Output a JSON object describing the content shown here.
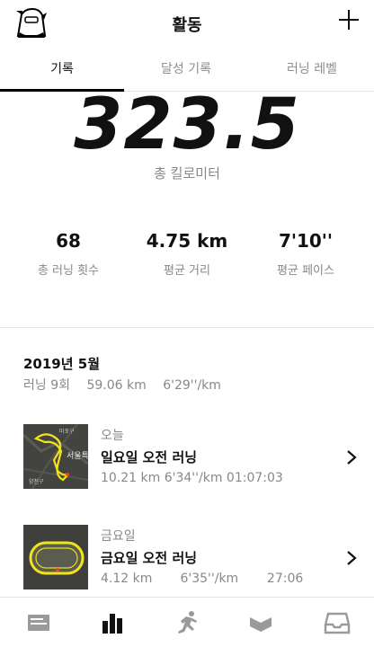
{
  "header": {
    "title": "활동"
  },
  "tabs": [
    {
      "label": "기록",
      "active": true
    },
    {
      "label": "달성 기록",
      "active": false
    },
    {
      "label": "러닝 레벨",
      "active": false
    }
  ],
  "total": {
    "value": "323.5",
    "label": "총 킬로미터"
  },
  "stats": [
    {
      "value": "68",
      "label": "총 러닝 횟수"
    },
    {
      "value": "4.75 km",
      "label": "평균 거리"
    },
    {
      "value": "7'10''",
      "label": "평균 페이스"
    }
  ],
  "month": {
    "title": "2019년 5월",
    "runs_count": "러닝 9회",
    "distance": "59.06 km",
    "pace": "6'29''/km"
  },
  "runs": [
    {
      "day": "오늘",
      "name": "일요일 오전 러닝",
      "distance": "10.21 km",
      "pace": "6'34''/km",
      "duration": "01:07:03"
    },
    {
      "day": "금요일",
      "name": "금요일 오전 러닝",
      "distance": "4.12 km",
      "pace": "6'35''/km",
      "duration": "27:06"
    }
  ],
  "map_labels": {
    "run1": [
      "마포구",
      "서울특",
      "양천구"
    ]
  },
  "bottom_nav": [
    {
      "icon": "feed-icon",
      "active": false
    },
    {
      "icon": "activity-chart-icon",
      "active": true
    },
    {
      "icon": "runner-icon",
      "active": false
    },
    {
      "icon": "plan-icon",
      "active": false
    },
    {
      "icon": "inbox-icon",
      "active": false
    }
  ],
  "colors": {
    "route": "#f2e31a",
    "accent": "#000000",
    "muted": "#888888"
  }
}
